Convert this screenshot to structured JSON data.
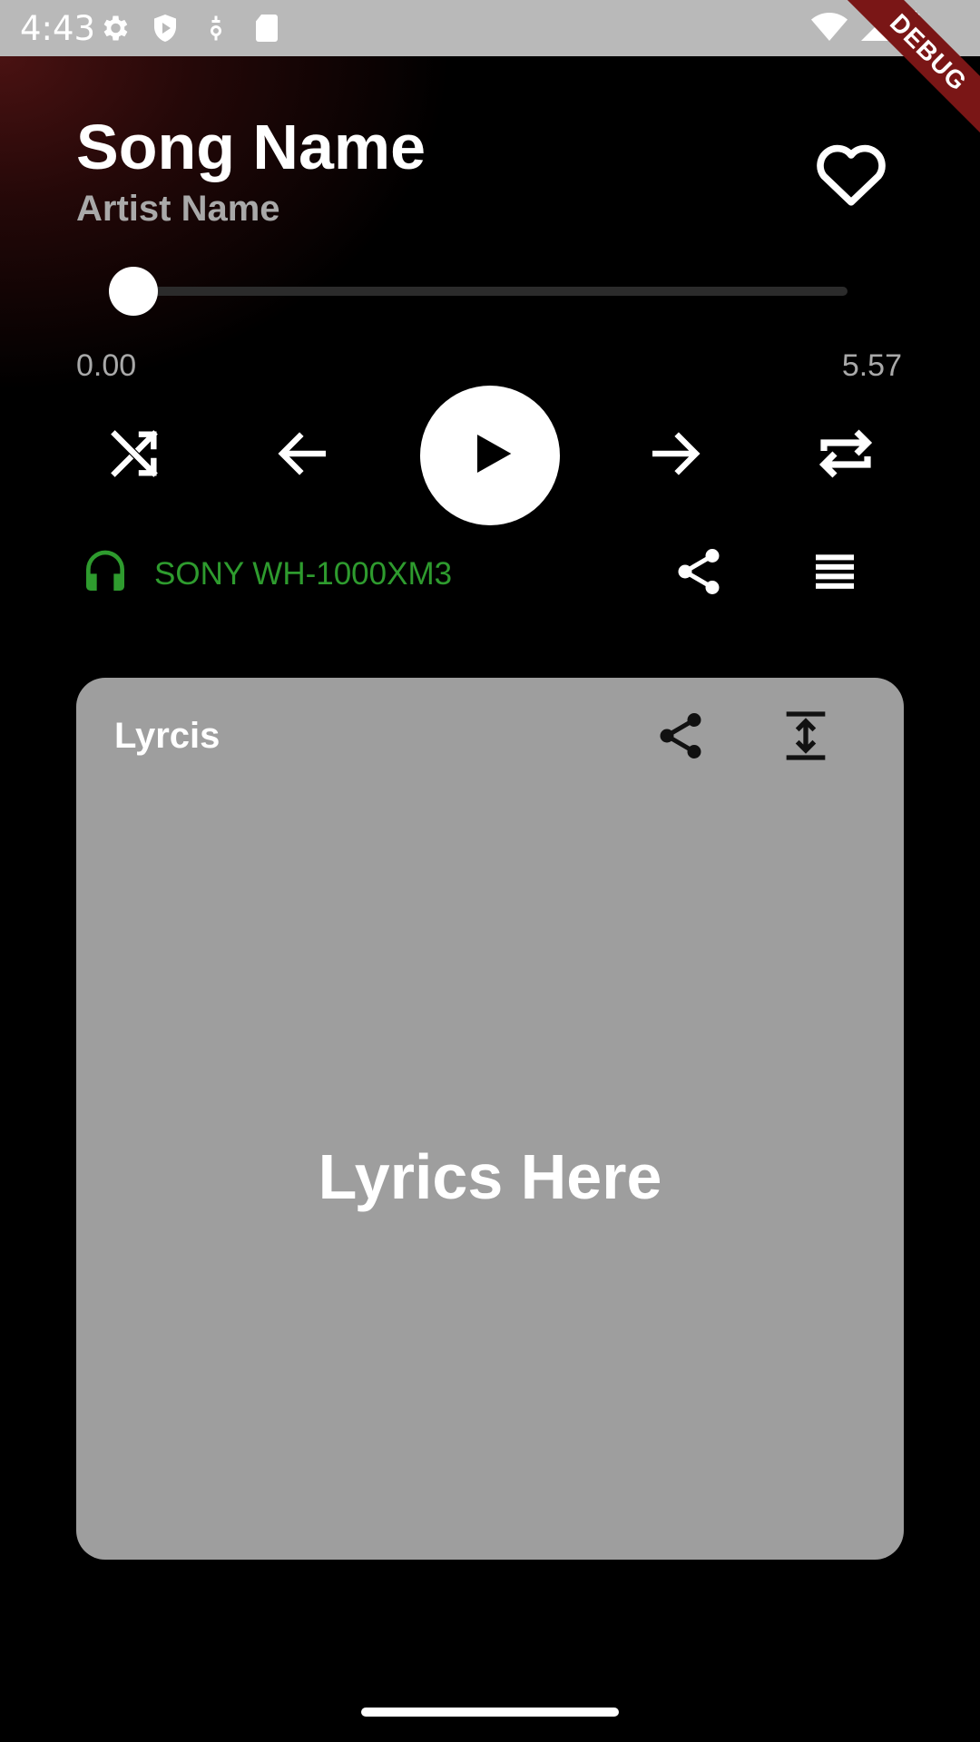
{
  "status_bar": {
    "time": "4:43",
    "icons": [
      "gear-icon",
      "shield-icon",
      "location-icon",
      "sd-card-icon",
      "wifi-icon",
      "signal-icon",
      "battery-icon"
    ]
  },
  "debug_banner": "DEBUG",
  "player": {
    "song_name": "Song Name",
    "artist_name": "Artist Name",
    "is_favorite": false,
    "elapsed": "0.00",
    "duration": "5.57",
    "progress_fraction": 0.0
  },
  "controls": [
    "shuffle-icon",
    "previous-icon",
    "play-icon",
    "next-icon",
    "repeat-icon"
  ],
  "device": {
    "name": "SONY WH-1000XM3",
    "color": "#2e9b2e"
  },
  "lyrics": {
    "title": "Lyrcis",
    "body": "Lyrics Here"
  },
  "colors": {
    "background": "#000000",
    "card": "#9e9e9e",
    "muted_text": "#a9a9a9",
    "accent_red": "#4a1212"
  }
}
